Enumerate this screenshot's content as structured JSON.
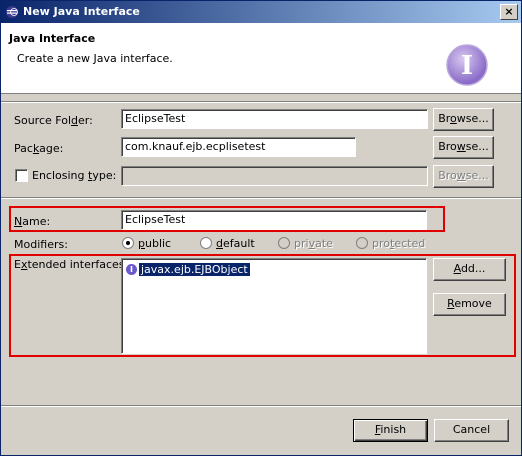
{
  "window": {
    "title": "New Java Interface",
    "close_glyph": "×"
  },
  "banner": {
    "title": "Java Interface",
    "description": "Create a new Java interface.",
    "icon_letter": "I"
  },
  "form": {
    "source_folder": {
      "label_pre": "Source Fol",
      "label_u": "d",
      "label_post": "er:",
      "value": "EclipseTest",
      "browse": {
        "pre": "Br",
        "u": "o",
        "post": "wse..."
      }
    },
    "package": {
      "label_pre": "Pac",
      "label_u": "k",
      "label_post": "age:",
      "value": "com.knauf.ejb.ecplisetest",
      "browse": {
        "pre": "Bro",
        "u": "w",
        "post": "se..."
      }
    },
    "enclosing": {
      "label_pre": "Enclosing ",
      "label_u": "t",
      "label_post": "ype:",
      "value": "",
      "browse": {
        "pre": "Bro",
        "u": "w",
        "post": "se..."
      }
    },
    "name": {
      "label_pre": "",
      "label_u": "N",
      "label_post": "ame:",
      "value": "EclipseTest"
    },
    "modifiers": {
      "label": "Modifiers:",
      "options": [
        {
          "pre": "",
          "u": "p",
          "post": "ublic",
          "checked": true,
          "disabled": false
        },
        {
          "pre": "",
          "u": "d",
          "post": "efault",
          "checked": false,
          "disabled": false
        },
        {
          "pre": "pri",
          "u": "v",
          "post": "ate",
          "checked": false,
          "disabled": true
        },
        {
          "pre": "pro",
          "u": "t",
          "post": "ected",
          "checked": false,
          "disabled": true
        }
      ]
    },
    "extended": {
      "label_pre": "E",
      "label_u": "x",
      "label_post": "tended interfaces:",
      "items": [
        "javax.ejb.EJBObject"
      ],
      "item_icon": "I",
      "add": {
        "pre": "",
        "u": "A",
        "post": "dd..."
      },
      "remove": {
        "pre": "",
        "u": "R",
        "post": "emove"
      }
    }
  },
  "footer": {
    "finish": {
      "pre": "",
      "u": "F",
      "post": "inish"
    },
    "cancel": "Cancel"
  },
  "colors": {
    "highlight_border": "#e00000",
    "titlebar_start": "#0a246a",
    "titlebar_end": "#a6caf0",
    "selection": "#0a246a"
  }
}
